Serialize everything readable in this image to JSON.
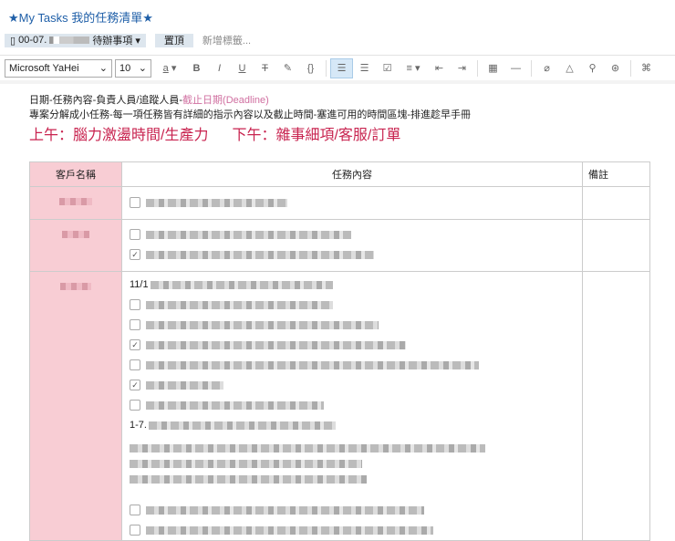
{
  "title": "★My Tasks 我的任務清單★",
  "tagbar": {
    "category_prefix": "00-07.",
    "category_suffix": "待辦事項 ▾",
    "pin": "置頂",
    "new_tag": "新增標籤..."
  },
  "toolbar": {
    "font": "Microsoft YaHei",
    "size": "10"
  },
  "desc": {
    "line1": "日期-任務內容-負責人員/追蹤人員-",
    "line1_pink": "截止日期(Deadline)",
    "line2": "專案分解成小任務-每一項任務皆有詳細的指示內容以及截止時間-塞進可用的時間區塊-排進趁早手冊"
  },
  "big": {
    "am": "上午：腦力激盪時間/生產力",
    "pm": "下午：雜事細項/客服/訂單"
  },
  "table": {
    "headers": [
      "客戶名稱",
      "任務內容",
      "備註"
    ],
    "row3_prefix1": "11/1",
    "row3_prefix2": "1-7."
  },
  "colors": {
    "accent": "#1f5fa8",
    "pink": "#f8cdd4",
    "red": "#c8234f"
  }
}
